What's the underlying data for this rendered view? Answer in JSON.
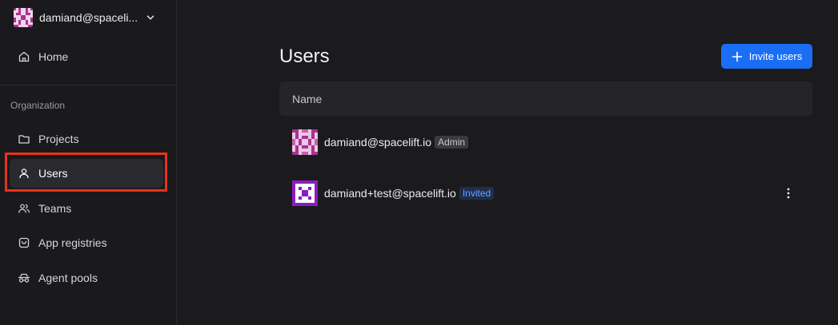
{
  "sidebar": {
    "account": {
      "name": "damiand@spaceli..."
    },
    "home_label": "Home",
    "section_label": "Organization",
    "items": [
      {
        "label": "Projects",
        "icon": "folder-icon"
      },
      {
        "label": "Users",
        "icon": "user-icon",
        "active": true
      },
      {
        "label": "Teams",
        "icon": "team-icon"
      },
      {
        "label": "App registries",
        "icon": "app-registry-icon"
      },
      {
        "label": "Agent pools",
        "icon": "agent-pool-icon"
      }
    ]
  },
  "main": {
    "title": "Users",
    "invite_button": "Invite users",
    "table": {
      "columns": [
        "Name"
      ],
      "rows": [
        {
          "email": "damiand@spacelift.io",
          "badge": "Admin"
        },
        {
          "email": "damiand+test@spacelift.io",
          "badge": "Invited"
        }
      ]
    }
  },
  "colors": {
    "accent": "#1a6ef5",
    "highlight": "#e8321c",
    "background": "#1b1b1d"
  }
}
